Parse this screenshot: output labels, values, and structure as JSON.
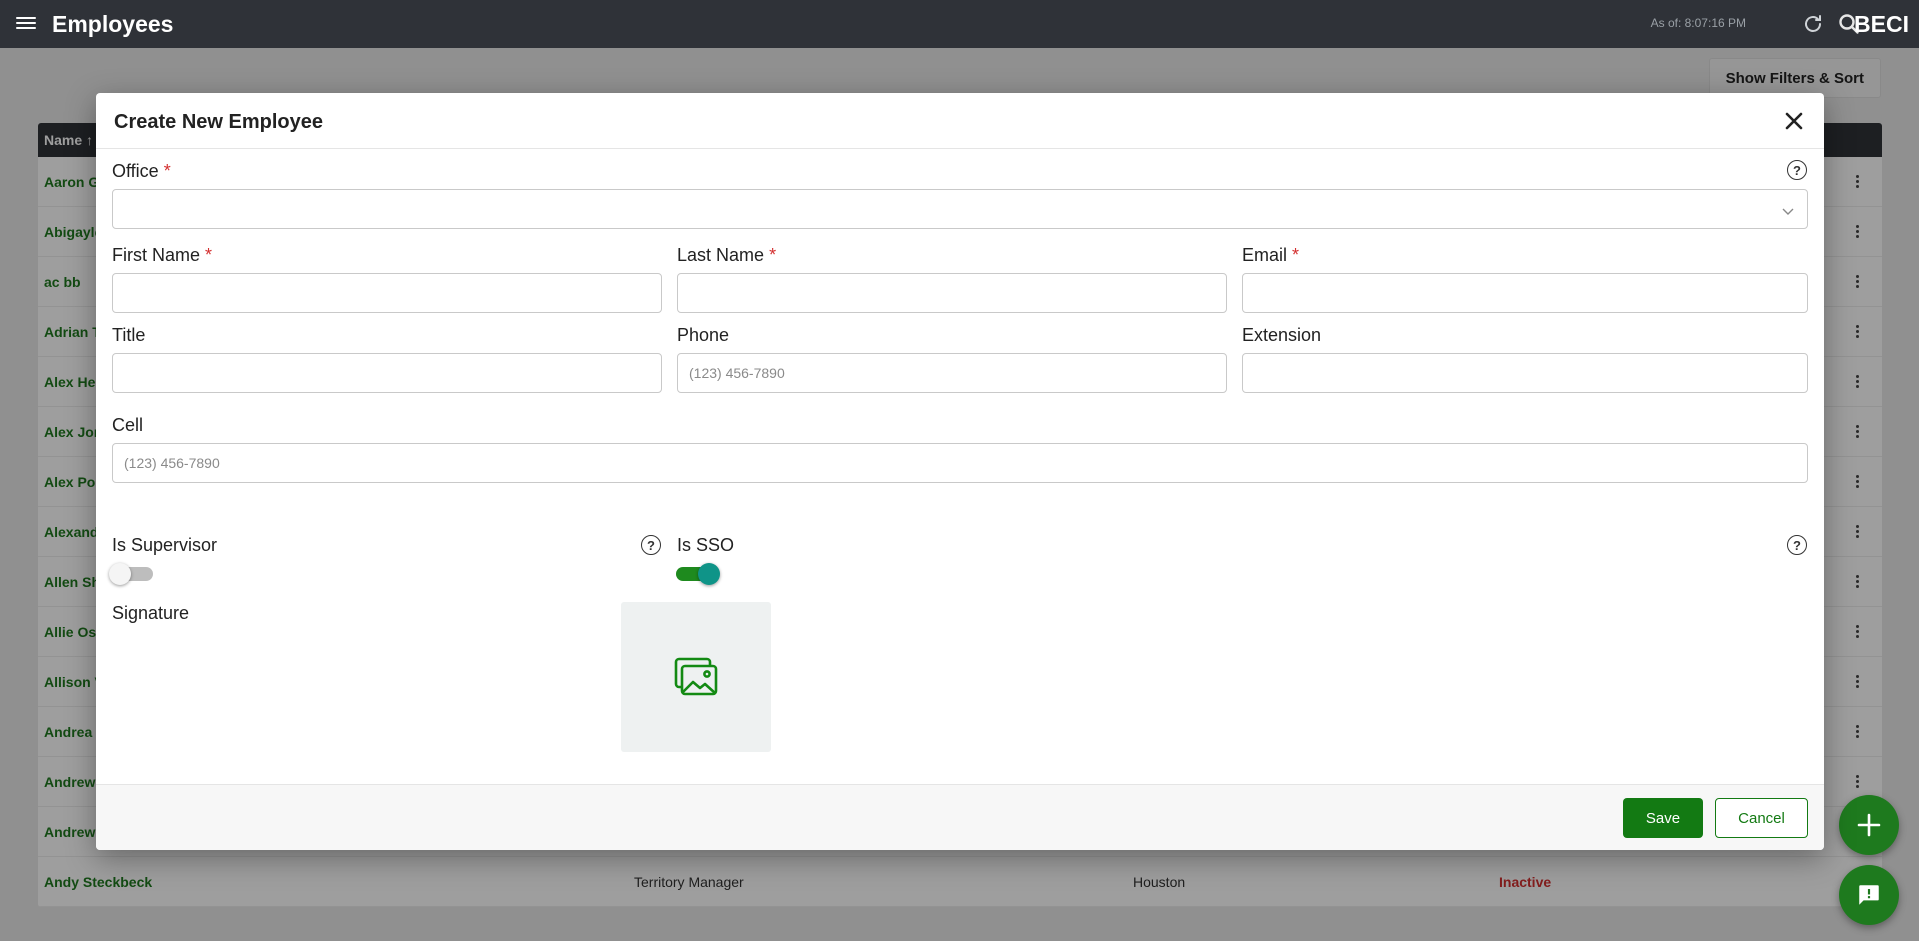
{
  "topbar": {
    "title": "Employees",
    "as_of": "As of: 8:07:16 PM",
    "brand": "BECI"
  },
  "toolbar": {
    "filters_label": "Show Filters & Sort"
  },
  "grid": {
    "header_name": "Name ↑",
    "rows": [
      {
        "name": "Aaron G"
      },
      {
        "name": "Abigayle"
      },
      {
        "name": "ac bb"
      },
      {
        "name": "Adrian T"
      },
      {
        "name": "Alex Her"
      },
      {
        "name": "Alex Jon"
      },
      {
        "name": "Alex Por"
      },
      {
        "name": "Alexand"
      },
      {
        "name": "Allen Sh"
      },
      {
        "name": "Allie Ost"
      },
      {
        "name": "Allison V"
      },
      {
        "name": "Andrea I"
      },
      {
        "name": "Andrew"
      },
      {
        "name": "Andrew"
      },
      {
        "name": "Andy Steckbeck",
        "title": "Territory Manager",
        "location": "Houston",
        "status": "Inactive"
      }
    ]
  },
  "modal": {
    "title": "Create New Employee",
    "office_label": "Office",
    "first_name_label": "First Name",
    "last_name_label": "Last Name",
    "email_label": "Email",
    "title_label": "Title",
    "phone_label": "Phone",
    "phone_placeholder": "(123) 456-7890",
    "extension_label": "Extension",
    "cell_label": "Cell",
    "cell_placeholder": "(123) 456-7890",
    "is_supervisor_label": "Is Supervisor",
    "is_supervisor_value": false,
    "is_sso_label": "Is SSO",
    "is_sso_value": true,
    "signature_label": "Signature",
    "required_mark": "*",
    "help_mark": "?",
    "save_label": "Save",
    "cancel_label": "Cancel"
  },
  "colors": {
    "accent": "#137a13",
    "topbar": "#2f3238",
    "required": "#d32f2f",
    "toggle_knob_on": "#0f9488"
  }
}
